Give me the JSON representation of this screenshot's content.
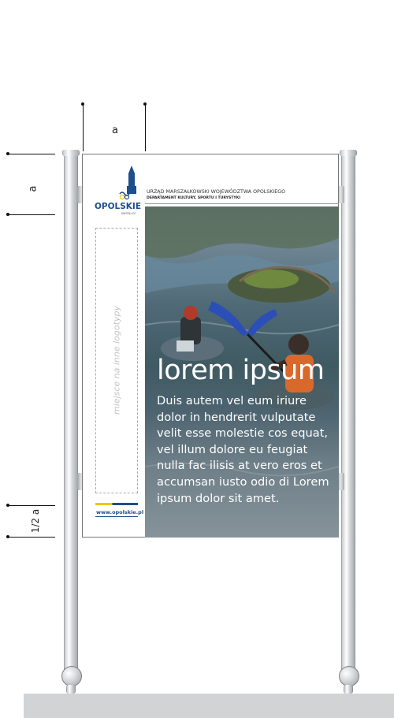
{
  "dimensions": {
    "top_label": "a",
    "side_label": "a",
    "bottom_side_label": "1/2 a"
  },
  "header": {
    "line1": "URZĄD MARSZAŁKOWSKI WOJEWÓDZTWA OPOLSKIEGO",
    "line2": "DEPARTAMENT KULTURY, SPORTU I TURYSTYKI"
  },
  "logo": {
    "name": "OPOLSKIE",
    "tagline": "KWITNĄCE"
  },
  "placeholder": {
    "text": "miejsce na inne logotypy"
  },
  "footer": {
    "url": "www.opolskie.pl"
  },
  "poster": {
    "title": "lorem ipsum",
    "body": "Duis autem vel eum iriure dolor in hendrerit vulputate velit esse molestie cos equat, vel illum dolore eu feugiat nulla fac ilisis at vero eros et accumsan iusto odio di Lorem ipsum dolor sit amet."
  },
  "colors": {
    "brand_blue": "#1e4e8c",
    "brand_yellow": "#f2c500",
    "ground": "#d2d3d5"
  }
}
